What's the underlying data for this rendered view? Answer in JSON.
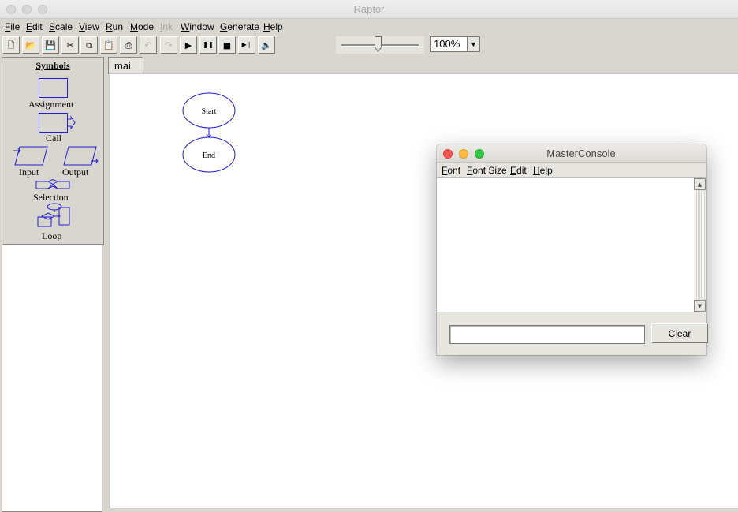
{
  "window": {
    "title": "Raptor"
  },
  "menu": [
    {
      "label": "File",
      "enabled": true
    },
    {
      "label": "Edit",
      "enabled": true
    },
    {
      "label": "Scale",
      "enabled": true
    },
    {
      "label": "View",
      "enabled": true
    },
    {
      "label": "Run",
      "enabled": true
    },
    {
      "label": "Mode",
      "enabled": true
    },
    {
      "label": "Ink",
      "enabled": false
    },
    {
      "label": "Window",
      "enabled": true
    },
    {
      "label": "Generate",
      "enabled": true
    },
    {
      "label": "Help",
      "enabled": true
    }
  ],
  "toolbar": {
    "buttons": [
      {
        "name": "new-file-icon",
        "glyph": "🗋",
        "enabled": true
      },
      {
        "name": "open-folder-icon",
        "glyph": "📂",
        "enabled": true
      },
      {
        "name": "save-icon",
        "glyph": "💾",
        "enabled": true
      },
      {
        "name": "cut-icon",
        "glyph": "✂",
        "enabled": true
      },
      {
        "name": "copy-icon",
        "glyph": "⧉",
        "enabled": true
      },
      {
        "name": "paste-icon",
        "glyph": "📋",
        "enabled": true
      },
      {
        "name": "print-icon",
        "glyph": "⎙",
        "enabled": true
      },
      {
        "name": "undo-icon",
        "glyph": "↶",
        "enabled": false
      },
      {
        "name": "redo-icon",
        "glyph": "↷",
        "enabled": false
      },
      {
        "name": "run-icon",
        "glyph": "▶",
        "enabled": true
      },
      {
        "name": "pause-icon",
        "glyph": "❚❚",
        "enabled": true
      },
      {
        "name": "stop-icon",
        "glyph": "■",
        "enabled": true
      },
      {
        "name": "step-icon",
        "glyph": "▶❘",
        "enabled": true
      },
      {
        "name": "speaker-icon",
        "glyph": "🔈",
        "enabled": true
      }
    ],
    "speed_slider_fraction": 0.47,
    "zoom": "100%"
  },
  "symbols": {
    "title": "Symbols",
    "assignment": "Assignment",
    "call": "Call",
    "input": "Input",
    "output": "Output",
    "selection": "Selection",
    "loop": "Loop"
  },
  "tabs": [
    {
      "label": "mai"
    }
  ],
  "flowchart": {
    "start": "Start",
    "end": "End"
  },
  "console": {
    "title": "MasterConsole",
    "menu": [
      "Font",
      "Font Size",
      "Edit",
      "Help"
    ],
    "input_value": "",
    "clear_label": "Clear"
  },
  "colors": {
    "flow_stroke": "#1f1fd0",
    "close": "#fc5753",
    "minimize": "#fdbc40",
    "zoom": "#33c748"
  }
}
